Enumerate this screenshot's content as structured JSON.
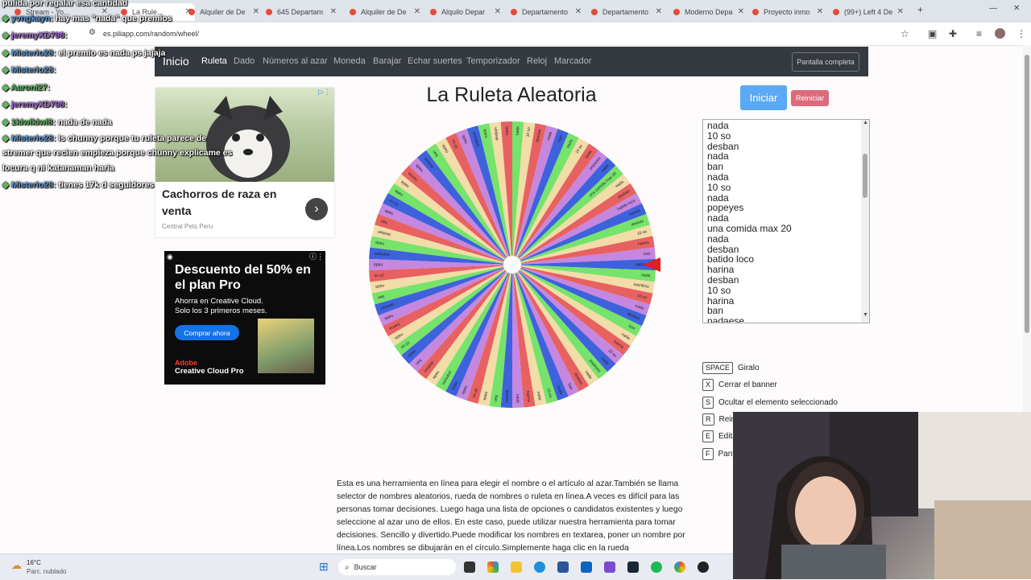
{
  "browser": {
    "tabs": [
      {
        "label": "Stream - Yo..."
      },
      {
        "label": "La Rule..."
      },
      {
        "label": "Alquiler de De"
      },
      {
        "label": "645 Departam"
      },
      {
        "label": "Alquiler de De"
      },
      {
        "label": "Alquilo Depar"
      },
      {
        "label": "Departamento"
      },
      {
        "label": "Departamento"
      },
      {
        "label": "Moderno Depa"
      },
      {
        "label": "Proyecto inmo"
      },
      {
        "label": "(99+) Left 4 De"
      }
    ],
    "url": "es.piliapp.com/random/wheel/"
  },
  "nav": {
    "brand": "Inicio",
    "items": [
      "Ruleta",
      "Dado",
      "Números al azar",
      "Moneda",
      "Barajar",
      "Echar suertes",
      "Temporizador",
      "Reloj",
      "Marcador"
    ],
    "fullscreen": "Pantalla completa"
  },
  "ads": {
    "ad1_title": "Cachorros de raza en venta",
    "ad1_source": "Central Pets Peru",
    "ad2_title": "Descuento del 50% en el plan Pro",
    "ad2_body": "Ahorra en Creative Cloud. Solo los 3 primeros meses.",
    "ad2_button": "Comprar ahora",
    "ad2_brand_top": "Adobe",
    "ad2_brand": "Creative Cloud Pro"
  },
  "wheel": {
    "title": "La Ruleta Aleatoria",
    "start": "Iniciar",
    "reset": "Reiniciar",
    "colors": [
      "#76e36b",
      "#f2dca8",
      "#e86161",
      "#c587e0",
      "#3e62dc"
    ],
    "segments": [
      "nada",
      "10 so",
      "desban",
      "nada",
      "ban",
      "nada",
      "10 so",
      "nada",
      "popeyes",
      "nada",
      "una comida max 20",
      "nada",
      "desban",
      "batido loco",
      "harina",
      "desban",
      "10 so",
      "harina",
      "ban",
      "nadaese",
      "nada",
      "sacrificio",
      "10 so",
      "nada",
      "desban",
      "ban",
      "nada",
      "harina",
      "10 so",
      "nada",
      "popeyes",
      "nada",
      "desban",
      "ban",
      "nada",
      "10 so",
      "nada",
      "harina",
      "nada",
      "desban",
      "ban",
      "nada",
      "10 so",
      "nada",
      "nada",
      "popeyes",
      "nada",
      "desban",
      "ban",
      "nada",
      "10 so",
      "nada",
      "harina",
      "nada",
      "desban",
      "ban",
      "nada",
      "10 so",
      "nada",
      "popeyes",
      "nada",
      "desban",
      "ban",
      "nada",
      "10 so",
      "nada",
      "nada",
      "harina",
      "nada",
      "desban",
      "ban",
      "nada",
      "10 so",
      "nada",
      "popeyes",
      "nada",
      "desban",
      "nada"
    ]
  },
  "textarea_lines": [
    "nada",
    "10 so",
    "desban",
    "nada",
    "ban",
    "nada",
    "10 so",
    "nada",
    "popeyes",
    "nada",
    "una comida max 20",
    "nada",
    "desban",
    "batido loco",
    "harina",
    "desban",
    "10 so",
    "harina",
    "ban",
    "nadaese"
  ],
  "shortcuts": [
    {
      "key": "SPACE",
      "label": "Giralo"
    },
    {
      "key": "X",
      "label": "Cerrar el banner"
    },
    {
      "key": "S",
      "label": "Ocultar el elemento seleccionado"
    },
    {
      "key": "R",
      "label": "Reini"
    },
    {
      "key": "E",
      "label": "Edita"
    },
    {
      "key": "F",
      "label": "Pant"
    }
  ],
  "description": "Esta es una herramienta en línea para elegir el nombre o el artículo al azar.También se llama selector de nombres aleatorios, rueda de nombres o ruleta en línea.A veces es difícil para las personas tomar decisiones. Luego haga una lista de opciones o candidatos existentes y luego seleccione al azar uno de ellos. En este caso, puede utilizar nuestra herramienta para tomar decisiones. Sencillo y divertido.Puede modificar los nombres en textarea, poner un nombre por línea.Los nombres se dibujarán en el círculo.Simplemente haga clic en la rueda",
  "chat": [
    {
      "user": "",
      "msg": "pulida por regalar esa cantidad"
    },
    {
      "user": "yvngkayn",
      "msg": ": hay mas \"nada\" que premios"
    },
    {
      "user": "jeremyXD798",
      "msg": ":"
    },
    {
      "user": "Misterio28",
      "msg": ": el premio es nada ps jajaja"
    },
    {
      "user": "Misterio28",
      "msg": ":"
    },
    {
      "user": "Aaroni27",
      "msg": ":"
    },
    {
      "user": "jeremyXD798",
      "msg": ":"
    },
    {
      "user": "1kiwikiwi8",
      "msg": ": nada de nada"
    },
    {
      "user": "Misterio28",
      "msg": ": ls chunny porque tu ruleta parece de"
    },
    {
      "user": "",
      "msg": "stremer que recien empieza porque chunny explicame es"
    },
    {
      "user": "",
      "msg": "locura q ni katanaman haria"
    },
    {
      "user": "Misterio28",
      "msg": ": tienes 17k d seguidores"
    }
  ],
  "taskbar": {
    "temp": "16°C",
    "weather": "Parc. nublado",
    "search": "Buscar"
  }
}
